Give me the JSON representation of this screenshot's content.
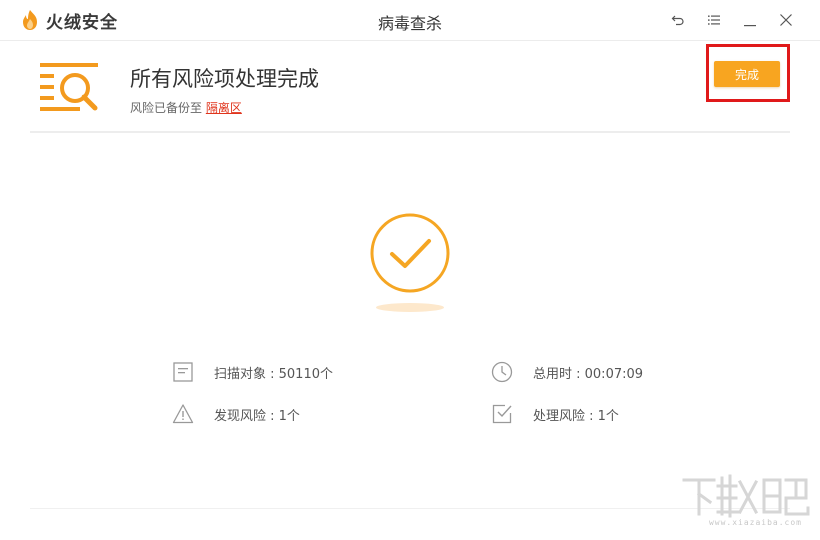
{
  "app": {
    "brand_name": "火绒安全",
    "window_title": "病毒查杀",
    "brand_color": "#f39a1e"
  },
  "window_controls": [
    {
      "icon": "back-icon"
    },
    {
      "icon": "menu-icon"
    },
    {
      "icon": "minimize-icon"
    },
    {
      "icon": "close-icon"
    }
  ],
  "header": {
    "title": "所有风险项处理完成",
    "subtitle_prefix": "风险已备份至 ",
    "quarantine_link": "隔离区",
    "done_button": "完成",
    "accent_color": "#f8a520",
    "link_color": "#e0341c"
  },
  "stats": {
    "scan_objects": "扫描对象 : 50110个",
    "total_time": "总用时 : 00:07:09",
    "found_risks": "发现风险 : 1个",
    "handled_risks": "处理风险 : 1个"
  },
  "watermark": {
    "text": "www.xiazaiba.com"
  }
}
